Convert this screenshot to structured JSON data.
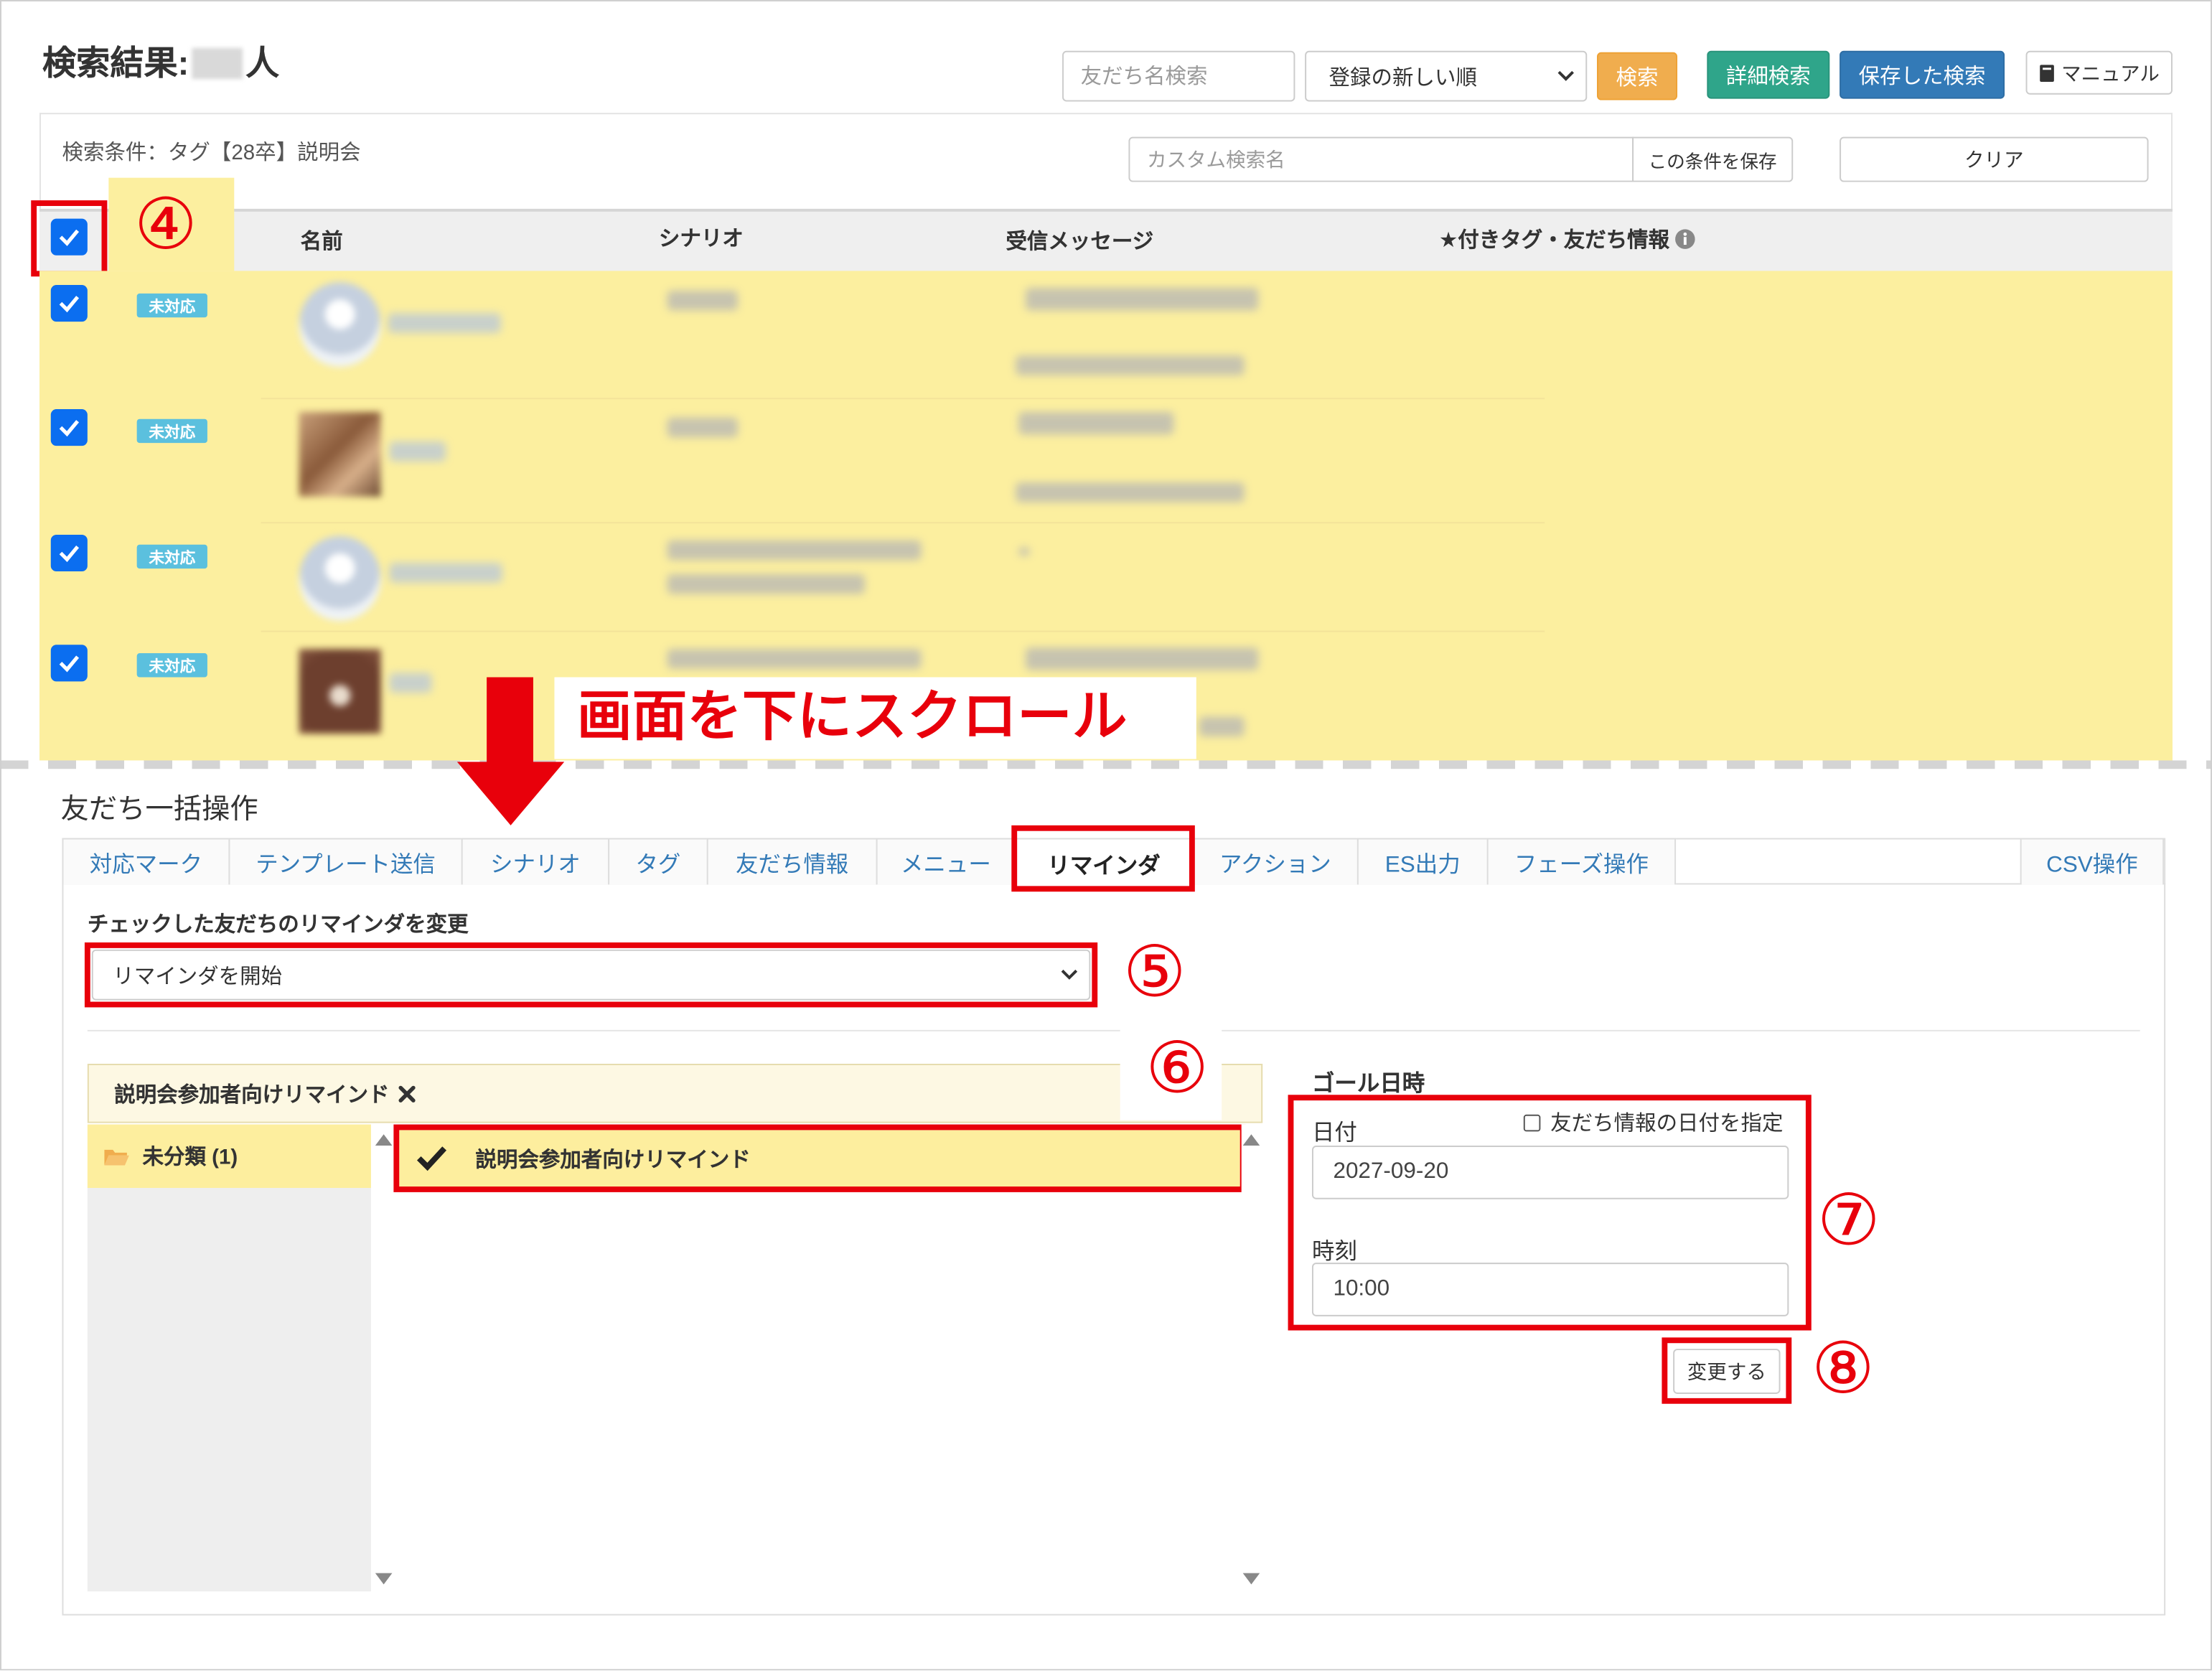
{
  "header": {
    "title_prefix": "検索結果:",
    "title_suffix": "人",
    "search_placeholder": "友だち名検索",
    "sort_selected": "登録の新しい順",
    "search_button": "検索",
    "advanced_search_button": "詳細検索",
    "saved_search_button": "保存した検索",
    "manual_button": "マニュアル"
  },
  "conditions": {
    "text": "検索条件：タグ【28卒】説明会",
    "custom_name_placeholder": "カスタム検索名",
    "save_button": "この条件を保存",
    "clear_button": "クリア"
  },
  "table": {
    "select_all_checked": true,
    "columns": {
      "name": "名前",
      "scenario": "シナリオ",
      "message": "受信メッセージ",
      "tags": "★付きタグ・友だち情報"
    },
    "rows": [
      {
        "checked": true,
        "badge": "未対応"
      },
      {
        "checked": true,
        "badge": "未対応"
      },
      {
        "checked": true,
        "badge": "未対応"
      },
      {
        "checked": true,
        "badge": "未対応"
      }
    ]
  },
  "annotations": {
    "step4": "④",
    "step5": "⑤",
    "step6": "⑥",
    "step7": "⑦",
    "step8": "⑧",
    "scroll_hint": "画面を下にスクロール"
  },
  "bulk": {
    "title": "友だち一括操作",
    "tabs": [
      {
        "label": "対応マーク"
      },
      {
        "label": "テンプレート送信"
      },
      {
        "label": "シナリオ"
      },
      {
        "label": "タグ"
      },
      {
        "label": "友だち情報"
      },
      {
        "label": "メニュー"
      },
      {
        "label": "リマインダ"
      },
      {
        "label": "アクション"
      },
      {
        "label": "ES出力"
      },
      {
        "label": "フェーズ操作"
      },
      {
        "label": "CSV操作"
      }
    ],
    "active_tab": "リマインダ",
    "section_label": "チェックした友だちのリマインダを変更",
    "action_selected": "リマインダを開始",
    "selected_reminder": "説明会参加者向けリマインド",
    "folders": [
      {
        "label": "未分類 (1)"
      }
    ],
    "reminders": [
      {
        "label": "説明会参加者向けリマインド",
        "checked": true
      }
    ],
    "goal": {
      "title": "ゴール日時",
      "date_label": "日付",
      "use_friend_date_label": "友だち情報の日付を指定",
      "use_friend_date_checked": false,
      "date_value": "2027-09-20",
      "time_label": "時刻",
      "time_value": "10:00",
      "submit": "変更する"
    }
  },
  "icons": {
    "manual": "book-icon",
    "info": "info-icon",
    "select_arrow": "chevron-down-icon",
    "remove": "close-icon",
    "folder": "folder-icon",
    "check": "check-icon",
    "scroll_hint": "arrow-down-icon"
  },
  "colors": {
    "annotation_red": "#e8000b",
    "highlight_yellow": "#fcef9f",
    "primary_blue": "#337ab7",
    "success_green": "#2fa58a",
    "warning_orange": "#f0ad4e",
    "badge_info": "#5bc0de",
    "checkbox_blue": "#0b6ef0"
  }
}
